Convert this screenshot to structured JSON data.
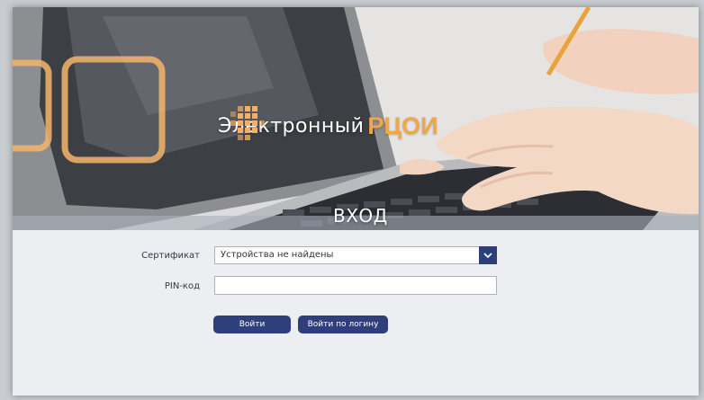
{
  "header": {
    "brand_prefix": "Электронный",
    "brand_name": "РЦОИ",
    "title": "ВХОД"
  },
  "form": {
    "certificate_label": "Сертификат",
    "certificate_value": "Устройства не найдены",
    "pin_label": "PIN-код",
    "pin_value": "",
    "login_button": "Войти",
    "login_by_username_button": "Войти по логину"
  },
  "colors": {
    "accent": "#2e3f7c",
    "brand_orange": "#f0a64b"
  },
  "icons": {
    "dropdown": "chevron-down-icon",
    "logo": "grid-logo-icon"
  }
}
